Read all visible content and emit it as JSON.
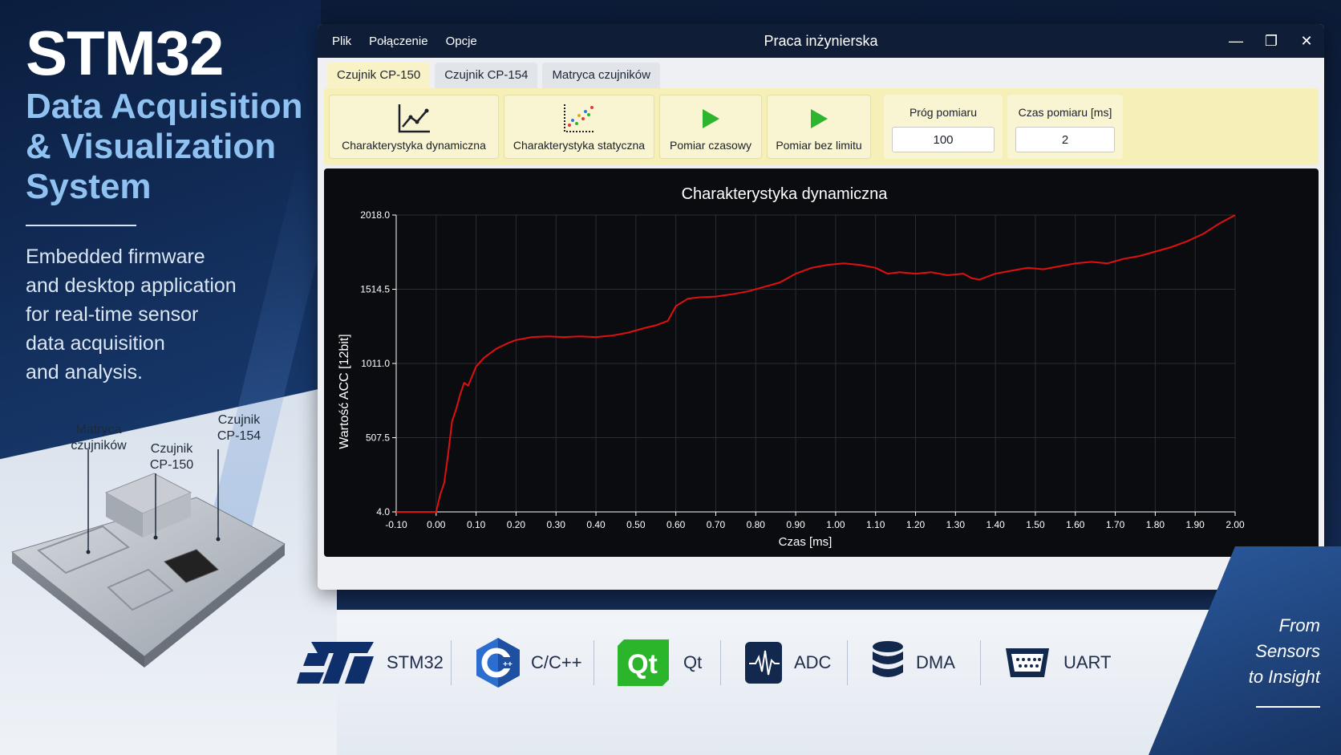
{
  "hero": {
    "title": "STM32",
    "subtitle_lines": [
      "Data Acquisition",
      "& Visualization",
      "System"
    ],
    "description_lines": [
      "Embedded firmware",
      "and desktop application",
      "for real-time sensor",
      "data acquisition",
      "and analysis."
    ]
  },
  "board_labels": {
    "matrix": [
      "Matryca",
      "czujników"
    ],
    "cp150": [
      "Czujnik",
      "CP-150"
    ],
    "cp154": [
      "Czujnik",
      "CP-154"
    ]
  },
  "window": {
    "title": "Praca inżynierska",
    "menu": [
      "Plik",
      "Połączenie",
      "Opcje"
    ],
    "controls": {
      "minimize": "—",
      "restore": "❐",
      "close": "✕"
    },
    "tabs": [
      {
        "label": "Czujnik CP-150",
        "active": true
      },
      {
        "label": "Czujnik CP-154",
        "active": false
      },
      {
        "label": "Matryca czujników",
        "active": false
      }
    ]
  },
  "toolbar": {
    "buttons": [
      {
        "label": "Charakterystyka dynamiczna",
        "icon": "line-chart-icon"
      },
      {
        "label": "Charakterystyka statyczna",
        "icon": "scatter-chart-icon"
      },
      {
        "label": "Pomiar czasowy",
        "icon": "play-icon"
      },
      {
        "label": "Pomiar bez limitu",
        "icon": "play-icon"
      }
    ],
    "threshold": {
      "label": "Próg pomiaru",
      "value": "100"
    },
    "duration": {
      "label": "Czas pomiaru [ms]",
      "value": "2"
    },
    "accent_color": "#f6f0b8",
    "play_color": "#2db52d"
  },
  "chart_data": {
    "type": "line",
    "title": "Charakterystyka dynamiczna",
    "xlabel": "Czas [ms]",
    "ylabel": "Wartość ACC [12bit]",
    "xlim": [
      -0.1,
      2.0
    ],
    "ylim": [
      4.0,
      2018.0
    ],
    "x_ticks": [
      "-0.10",
      "0.00",
      "0.10",
      "0.20",
      "0.30",
      "0.40",
      "0.50",
      "0.60",
      "0.70",
      "0.80",
      "0.90",
      "1.00",
      "1.10",
      "1.20",
      "1.30",
      "1.40",
      "1.50",
      "1.60",
      "1.70",
      "1.80",
      "1.90",
      "2.00"
    ],
    "y_ticks": [
      "4.0",
      "507.5",
      "1011.0",
      "1514.5",
      "2018.0"
    ],
    "grid": true,
    "line_color": "#e01010",
    "series": [
      {
        "x": [
          -0.1,
          -0.05,
          0.0,
          0.01,
          0.02,
          0.03,
          0.04,
          0.05,
          0.06,
          0.07,
          0.08,
          0.1,
          0.12,
          0.15,
          0.18,
          0.2,
          0.24,
          0.28,
          0.32,
          0.36,
          0.4,
          0.44,
          0.48,
          0.52,
          0.55,
          0.58,
          0.6,
          0.63,
          0.66,
          0.7,
          0.74,
          0.78,
          0.82,
          0.86,
          0.9,
          0.94,
          0.98,
          1.02,
          1.06,
          1.1,
          1.13,
          1.16,
          1.2,
          1.24,
          1.28,
          1.32,
          1.34,
          1.36,
          1.4,
          1.44,
          1.48,
          1.52,
          1.56,
          1.6,
          1.64,
          1.68,
          1.72,
          1.76,
          1.8,
          1.84,
          1.88,
          1.92,
          1.96,
          2.0
        ],
        "values": [
          4,
          4,
          4,
          120,
          200,
          400,
          620,
          700,
          800,
          880,
          860,
          990,
          1050,
          1110,
          1150,
          1170,
          1190,
          1195,
          1190,
          1195,
          1190,
          1200,
          1220,
          1250,
          1270,
          1300,
          1400,
          1450,
          1460,
          1465,
          1480,
          1500,
          1530,
          1560,
          1620,
          1660,
          1680,
          1690,
          1680,
          1660,
          1620,
          1630,
          1620,
          1630,
          1610,
          1620,
          1590,
          1580,
          1620,
          1640,
          1660,
          1650,
          1670,
          1690,
          1700,
          1690,
          1720,
          1740,
          1770,
          1800,
          1840,
          1890,
          1960,
          2018
        ]
      }
    ]
  },
  "tech_stack": [
    "STM32",
    "C/C++",
    "Qt",
    "ADC",
    "DMA",
    "UART"
  ],
  "slogan_lines": [
    "From",
    "Sensors",
    "to Insight"
  ]
}
